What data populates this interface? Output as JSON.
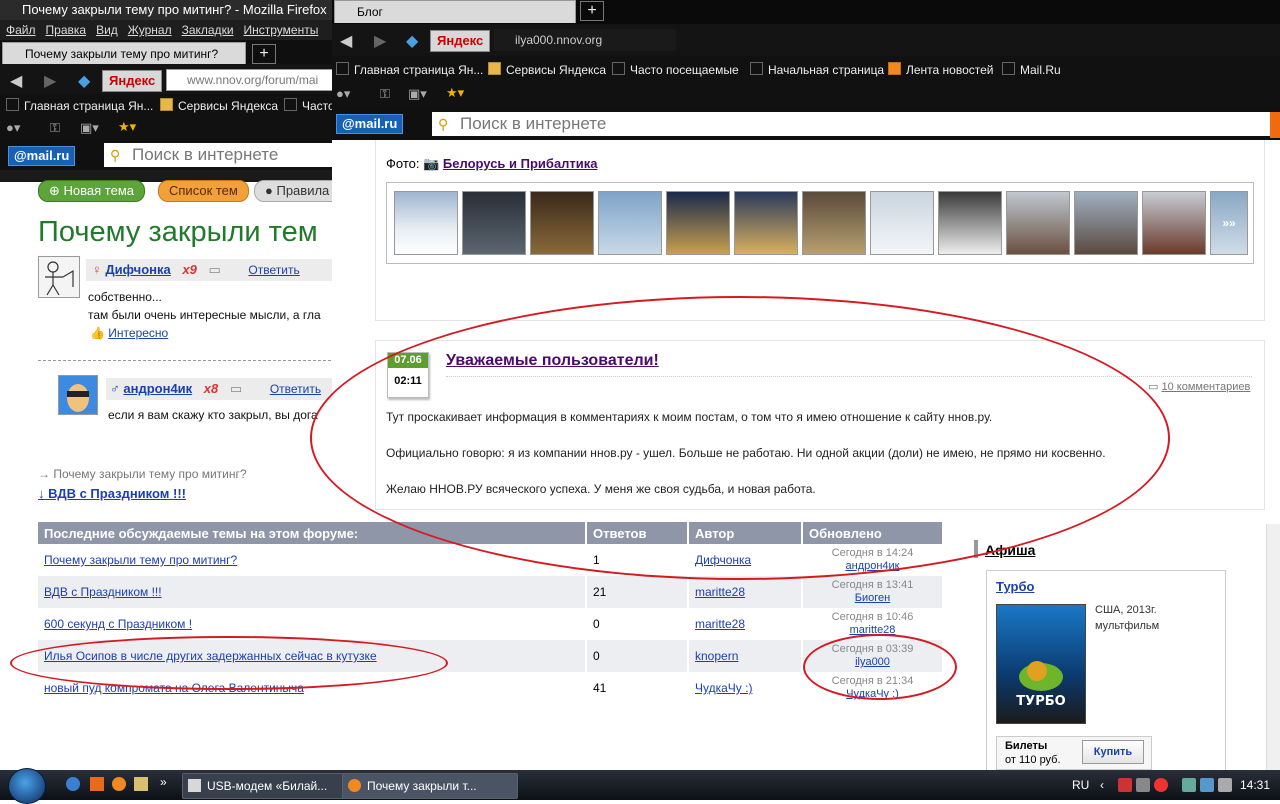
{
  "back_window": {
    "title": "Почему закрыли тему про митинг? - Mozilla Firefox",
    "menu": [
      "Файл",
      "Правка",
      "Вид",
      "Журнал",
      "Закладки",
      "Инструменты"
    ],
    "tab_title": "Почему закрыли тему про митинг?",
    "yandex_label": "Яндекс",
    "url": "www.nnov.org/forum/mai",
    "bookmarks": [
      "Главная страница Ян...",
      "Сервисы Яндекса",
      "Часто"
    ],
    "mail_badge": "@mail.ru",
    "search_placeholder": "Поиск в интернете"
  },
  "forum": {
    "buttons": [
      "Новая тема",
      "Список тем",
      "Правила"
    ],
    "title": "Почему закрыли тем",
    "post1": {
      "user": "Дифчонка",
      "karma": "x9",
      "reply": "Ответить",
      "line1": "собственно...",
      "line2": "там были очень интересные мысли, а гла",
      "like": "Интересно"
    },
    "post2": {
      "user": "андрон4ик",
      "karma": "x8",
      "reply": "Ответить",
      "line1": "если я вам скажу кто закрыл, вы дога"
    },
    "nav_prev": "→ Почему закрыли тему про митинг?",
    "nav_next": "↓ ВДВ с Праздником !!!"
  },
  "topics_table": {
    "headers": [
      "Последние обсуждаемые темы на этом форуме:",
      "Ответов",
      "Автор",
      "Обновлено"
    ],
    "rows": [
      {
        "topic": "Почему закрыли тему про митинг?",
        "replies": "1",
        "author": "Дифчонка",
        "updated": "Сегодня в 14:24",
        "updater": "андрон4ик"
      },
      {
        "topic": "ВДВ с Праздником !!!",
        "replies": "21",
        "author": "maritte28",
        "updated": "Сегодня в 13:41",
        "updater": "Биоген"
      },
      {
        "topic": "600 секунд с Праздником !",
        "replies": "0",
        "author": "maritte28",
        "updated": "Сегодня в 10:46",
        "updater": "maritte28"
      },
      {
        "topic": "Илья Осипов в числе других задержанных сейчас в кутузке",
        "replies": "0",
        "author": "knopern",
        "updated": "Сегодня в 03:39",
        "updater": "ilya000"
      },
      {
        "topic": "новый пуд компромата на Олега Валентиныча",
        "replies": "41",
        "author": "ЧудкаЧу :)",
        "updated": "Сегодня в 21:34",
        "updater": "ЧудкаЧу :)"
      }
    ]
  },
  "front_window": {
    "tab_title": "Блог",
    "yandex_label": "Яндекс",
    "url": "ilya000.nnov.org",
    "bookmarks": [
      "Главная страница Ян...",
      "Сервисы Яндекса",
      "Часто посещаемые",
      "Начальная страница",
      "Лента новостей",
      "Mail.Ru"
    ],
    "mail_badge": "@mail.ru",
    "search_placeholder": "Поиск в интернете"
  },
  "blog": {
    "photo_label": "Фото:",
    "photo_album": "Белорусь и Прибалтика",
    "post_date": "07.06",
    "post_time": "02:11",
    "post_title": "Уважаемые пользователи!",
    "comments": "10 комментариев",
    "paragraphs": [
      "Тут проскакивает информация в комментариях к моим постам, о том что я имею отношение к сайту ннов.ру.",
      "Официально говорю: я из компании ннов.ру - ушел. Больше не работаю. Ни одной акции (доли) не имею, не прямо ни косвенно.",
      "Желаю ННОВ.РУ всяческого успеха. У меня же своя судьба, и новая работа."
    ]
  },
  "afisha": {
    "heading": "Афиша",
    "movie": "Турбо",
    "meta1": "США, 2013г.",
    "meta2": "мультфильм",
    "tickets": "Билеты",
    "price": "от 110 руб.",
    "buy": "Купить"
  },
  "taskbar": {
    "items": [
      "USB-модем «Билай...",
      "Почему закрыли т..."
    ],
    "lang": "RU",
    "clock": "14:31"
  }
}
